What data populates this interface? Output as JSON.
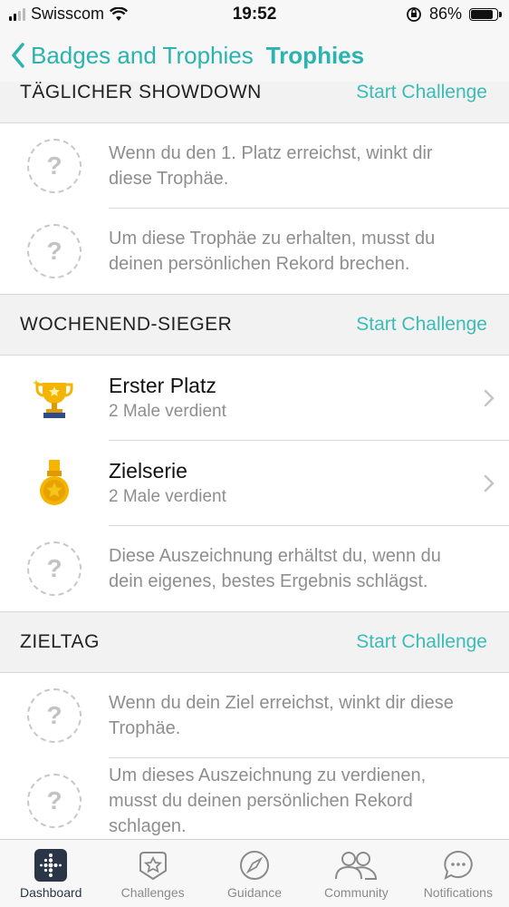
{
  "status": {
    "carrier": "Swisscom",
    "time": "19:52",
    "battery": "86%"
  },
  "nav": {
    "back_label": "Badges and Trophies",
    "title": "Trophies"
  },
  "sections": [
    {
      "title": "TÄGLICHER SHOWDOWN",
      "cta": "Start Challenge",
      "rows": [
        {
          "desc": "Wenn du den 1. Platz erreichst, winkt dir diese Trophäe."
        },
        {
          "desc": "Um diese Trophäe zu erhalten, musst du deinen persönlichen Rekord brechen."
        }
      ]
    },
    {
      "title": "WOCHENEND-SIEGER",
      "cta": "Start Challenge",
      "rows": [
        {
          "name": "Erster Platz",
          "sub": "2 Male verdient",
          "icon": "trophy-icon"
        },
        {
          "name": "Zielserie",
          "sub": "2 Male verdient",
          "icon": "medal-icon"
        },
        {
          "desc": "Diese Auszeichnung erhältst du, wenn du dein eigenes, bestes Ergebnis schlägst."
        }
      ]
    },
    {
      "title": "ZIELTAG",
      "cta": "Start Challenge",
      "rows": [
        {
          "desc": "Wenn du dein Ziel erreichst, winkt dir diese Trophäe."
        },
        {
          "desc": "Um dieses Auszeichnung zu verdienen, musst du deinen persönlichen Rekord schlagen."
        }
      ]
    }
  ],
  "tabs": [
    {
      "label": "Dashboard",
      "icon": "dashboard-icon",
      "active": true
    },
    {
      "label": "Challenges",
      "icon": "star-badge-icon"
    },
    {
      "label": "Guidance",
      "icon": "compass-icon"
    },
    {
      "label": "Community",
      "icon": "people-icon"
    },
    {
      "label": "Notifications",
      "icon": "chat-bubble-icon"
    }
  ],
  "colors": {
    "accent": "#2bb3b0",
    "muted": "#8e8e8e"
  }
}
